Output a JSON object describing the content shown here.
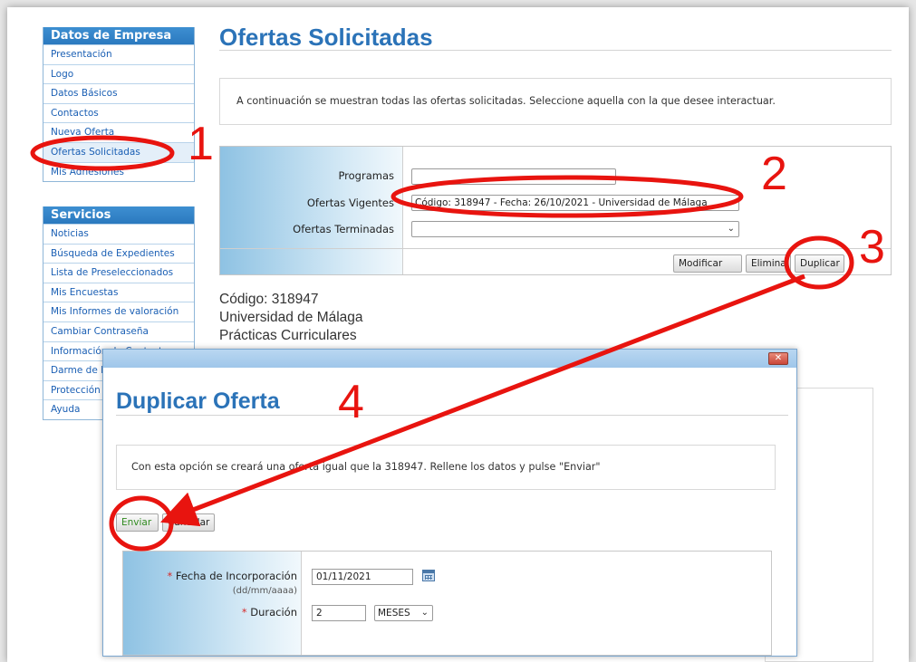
{
  "sidebar": {
    "company_title": "Datos de Empresa",
    "company_items": [
      {
        "label": "Presentación"
      },
      {
        "label": "Logo"
      },
      {
        "label": "Datos Básicos"
      },
      {
        "label": "Contactos"
      },
      {
        "label": "Nueva Oferta"
      },
      {
        "label": "Ofertas Solicitadas"
      },
      {
        "label": "Mis Adhesiones"
      }
    ],
    "services_title": "Servicios",
    "services_items": [
      {
        "label": "Noticias"
      },
      {
        "label": "Búsqueda de Expedientes"
      },
      {
        "label": "Lista de Preseleccionados"
      },
      {
        "label": "Mis Encuestas"
      },
      {
        "label": "Mis Informes de valoración"
      },
      {
        "label": "Cambiar Contraseña"
      },
      {
        "label": "Información de Contacto"
      },
      {
        "label": "Darme de Ba"
      },
      {
        "label": "Protección de"
      },
      {
        "label": "Ayuda"
      }
    ]
  },
  "main": {
    "title": "Ofertas Solicitadas",
    "info": "A continuación se muestran todas las ofertas solicitadas. Seleccione aquella con la que desee interactuar.",
    "form": {
      "programas_label": "Programas",
      "programas_value": "",
      "vigentes_label": "Ofertas Vigentes",
      "vigentes_value": "Código: 318947 - Fecha: 26/10/2021 - Universidad de Málaga",
      "terminadas_label": "Ofertas Terminadas",
      "terminadas_value": ""
    },
    "buttons": {
      "modificar": "Modificar",
      "eliminar": "Elimina",
      "duplicar": "Duplicar"
    },
    "detail": {
      "codigo": "Código: 318947",
      "universidad": "Universidad de Málaga",
      "tipo": "Prácticas Curriculares"
    }
  },
  "modal": {
    "close_glyph": "✕",
    "title": "Duplicar Oferta",
    "info": "Con esta opción se creará una oferta igual que la 318947. Rellene los datos y pulse \"Enviar\"",
    "enviar": "Enviar",
    "cancelar": "Cancelar",
    "fecha_label": "Fecha de Incorporación",
    "fecha_hint": "(dd/mm/aaaa)",
    "fecha_value": "01/11/2021",
    "duracion_label": "Duración",
    "duracion_value": "2",
    "duracion_unit": "MESES",
    "required_mark": "*"
  },
  "annotations": {
    "steps": [
      "1",
      "2",
      "3",
      "4"
    ],
    "color": "#e8140f"
  },
  "colors": {
    "accent": "#2b73b8",
    "link": "#1a5fb4",
    "sidebar_header": "#2b79bf",
    "enviar_text": "#2f8a1f"
  }
}
